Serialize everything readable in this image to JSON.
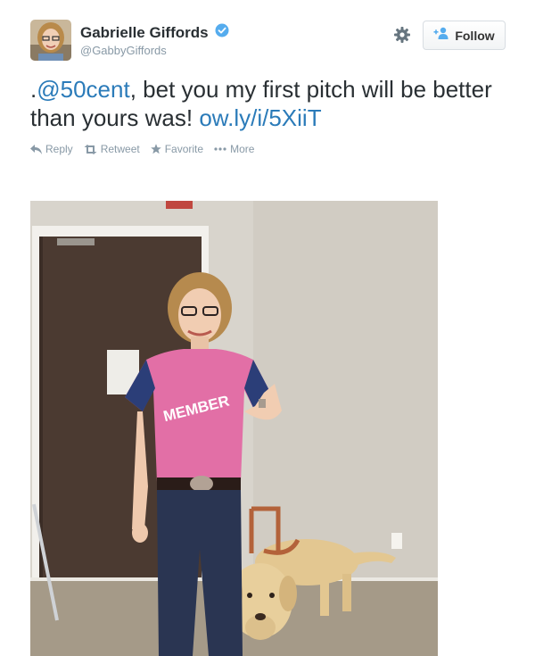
{
  "tweet": {
    "author": {
      "fullname": "Gabrielle Giffords",
      "username": "@GabbyGiffords",
      "verified": true
    },
    "follow_label": "Follow",
    "text": {
      "prefix": ".",
      "mention": "@50cent",
      "body": ", bet you my first pitch will be better than yours was! ",
      "link": "ow.ly/i/5XiiT"
    },
    "actions": {
      "reply": "Reply",
      "retweet": "Retweet",
      "favorite": "Favorite",
      "more": "More"
    },
    "photo": {
      "shirt_text": "MEMBER"
    }
  },
  "colors": {
    "link": "#2b7bb9",
    "verified": "#55acee",
    "muted": "#8899a6"
  }
}
